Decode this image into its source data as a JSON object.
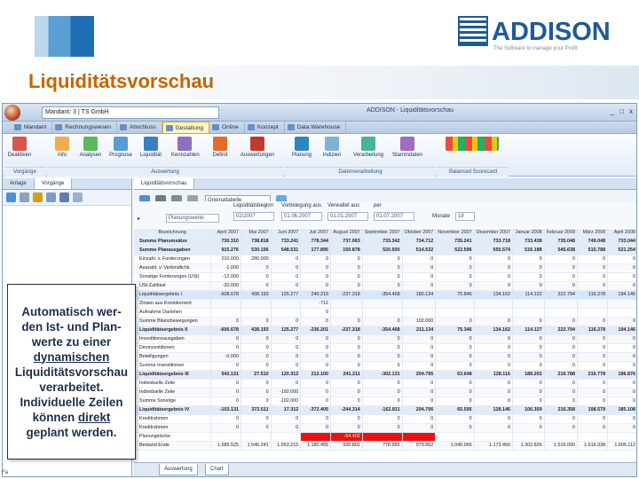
{
  "slide": {
    "title": "Liquiditätsvorschau",
    "brand_name": "ADDISON",
    "brand_tagline": "The Software to manage your Profit",
    "callout": {
      "line1": "Automatisch wer-",
      "line2": "den Ist- und Plan-",
      "line3": "werte zu einer",
      "line4": "dynamischen",
      "line5": "Liquiditätsvorschau",
      "line6": "verarbeitet.",
      "line7": "Individuelle Zeilen",
      "line8": "können ",
      "line8_underlined": "direkt",
      "line9": "geplant werden."
    }
  },
  "colors": {
    "title": "#c86400",
    "brand": "#1f5a98",
    "negative_highlight": "#ee1010",
    "callout_text": "#1c2f4a"
  },
  "app": {
    "mandant": "Mandant: 3 | TS GmbH",
    "window_title": "ADDISON - Liquiditätsvorschau",
    "win_controls": [
      "_",
      "□",
      "x"
    ],
    "ribbon_tabs": [
      "Mandant",
      "Rechnungswesen",
      "Abschluss",
      "Gestaltung",
      "Online",
      "Konzept",
      "Data Warehouse"
    ],
    "active_tab_index": 3,
    "ribbon_buttons": [
      "Deaktiven",
      "Info",
      "Analysen",
      "Prognose",
      "Liquidität",
      "Kennzahlen",
      "Definit",
      "Auswertungen",
      "Planung",
      "Indizien",
      "Verarbeitung",
      "Stammdaten",
      "Balanced Scorecard"
    ],
    "ribbon_groups": [
      "Vorgänge",
      "Auswertung",
      "Datenverarbeitung",
      "Balanced Scorecard"
    ],
    "left_pane_tabs": [
      "Anlage",
      "Vorgänge"
    ],
    "right_pane_tab": "Liquiditätsvorschau",
    "view_select": "Originaltabelle",
    "filter": {
      "view_label": "Planungswerte",
      "start_label": "Liquiditätsbeginn",
      "start_value": "02/2007",
      "vorgabe_label": "Vorbelegung aus",
      "vorgabe_value": "01.06.2007",
      "verwaltung_label": "Verwaltet aus",
      "verwaltung_value": "01.01.2007",
      "period_label": "per",
      "period_value": "01.07.2007",
      "monate_label": "Monate",
      "monate_value": "18"
    },
    "columns": [
      "Bezeichnung",
      "April 2007",
      "Mai 2007",
      "Juni 2007",
      "Juli 2007",
      "August 2007",
      "September 2007",
      "Oktober 2007",
      "November 2007",
      "Dezember 2007",
      "Januar 2008",
      "Februar 2008",
      "März 2008",
      "April 2008"
    ],
    "rows": [
      {
        "label": "Summe Planumsätze",
        "type": "sum",
        "values": [
          "730.310",
          "738.818",
          "733.241",
          "778.344",
          "737.063",
          "733.342",
          "734.712",
          "735.241",
          "733.718",
          "733.438",
          "735.048",
          "749.048",
          "733.044"
        ]
      },
      {
        "label": "Summe Planausgaben",
        "type": "sum",
        "values": [
          "915.276",
          "530.156",
          "548.531",
          "177.895",
          "150.878",
          "520.500",
          "514.532",
          "522.596",
          "555.574",
          "516.188",
          "545.638",
          "515.788",
          "521.254"
        ]
      },
      {
        "label": "Einzahl. v. Forderungen",
        "type": "row",
        "values": [
          "210.000",
          "280.000",
          "0",
          "0",
          "0",
          "0",
          "0",
          "0",
          "0",
          "0",
          "0",
          "0",
          "0"
        ]
      },
      {
        "label": "Auszahl. v. Verbindlichk.",
        "type": "row",
        "values": [
          "-1.000",
          "0",
          "0",
          "0",
          "0",
          "0",
          "0",
          "0",
          "0",
          "0",
          "0",
          "0",
          "0"
        ]
      },
      {
        "label": "Sonstige Forderungen (USt)",
        "type": "row",
        "values": [
          "-12.000",
          "0",
          "0",
          "0",
          "0",
          "0",
          "0",
          "0",
          "0",
          "0",
          "0",
          "0",
          "0"
        ]
      },
      {
        "label": "USt-Zahllast",
        "type": "row",
        "values": [
          "-20.000",
          "0",
          "0",
          "0",
          "0",
          "0",
          "0",
          "0",
          "0",
          "0",
          "0",
          "0",
          "0"
        ]
      },
      {
        "label": "Liquiditätsergebnis I",
        "type": "hl",
        "values": [
          "-608.678",
          "438.193",
          "125.277",
          "240.219",
          "-237.318",
          "-354.468",
          "180.134",
          "75.846",
          "134.162",
          "114.122",
          "222.794",
          "116.278",
          "194.146"
        ]
      },
      {
        "label": "Zinsen aus Kontokorrent",
        "type": "row",
        "values": [
          "",
          "",
          "",
          "-712",
          "",
          "",
          "",
          "",
          "",
          "",
          "",
          "",
          ""
        ]
      },
      {
        "label": "Aufnahme Darlehen",
        "type": "row",
        "values": [
          "",
          "",
          "",
          "0",
          "",
          "",
          "",
          "",
          "",
          "",
          "",
          "",
          ""
        ]
      },
      {
        "label": "Summe Bilanzbewegungen",
        "type": "row",
        "values": [
          "0",
          "0",
          "0",
          "0",
          "0",
          "0",
          "102.000",
          "0",
          "0",
          "0",
          "0",
          "0",
          "0"
        ]
      },
      {
        "label": "Liquiditätsergebnis II",
        "type": "sum",
        "values": [
          "-606.678",
          "438.193",
          "125.277",
          "-236.201",
          "-237.318",
          "-354.468",
          "211.134",
          "75.346",
          "134.162",
          "114.127",
          "222.794",
          "116.278",
          "194.146"
        ]
      },
      {
        "label": "Investitionsausgaben",
        "type": "row",
        "values": [
          "0",
          "0",
          "0",
          "0",
          "0",
          "0",
          "0",
          "0",
          "0",
          "0",
          "0",
          "0",
          "0"
        ]
      },
      {
        "label": "Desinvestitionen",
        "type": "row",
        "values": [
          "0",
          "0",
          "0",
          "0",
          "0",
          "0",
          "0",
          "0",
          "0",
          "0",
          "0",
          "0",
          "0"
        ]
      },
      {
        "label": "Beteiligungen",
        "type": "row",
        "values": [
          "-0.000",
          "0",
          "0",
          "0",
          "0",
          "0",
          "0",
          "0",
          "0",
          "0",
          "0",
          "0",
          "0"
        ]
      },
      {
        "label": "Summe Investitionen",
        "type": "row",
        "values": [
          "0",
          "0",
          "0",
          "0",
          "0",
          "0",
          "0",
          "0",
          "0",
          "0",
          "0",
          "0",
          "0"
        ]
      },
      {
        "label": "Liquiditätsergebnis III",
        "type": "sum",
        "values": [
          "542.131",
          "27.510",
          "120.312",
          "212.100",
          "241.211",
          "-302.131",
          "204.795",
          "63.648",
          "128.116",
          "188.202",
          "216.788",
          "216.778",
          "186.876"
        ]
      },
      {
        "label": "Individuelle Zeile",
        "type": "row",
        "values": [
          "0",
          "0",
          "0",
          "0",
          "0",
          "0",
          "0",
          "0",
          "0",
          "0",
          "0",
          "0",
          "0"
        ]
      },
      {
        "label": "Individuelle Zeile",
        "type": "row",
        "values": [
          "0",
          "0",
          "-192.000",
          "0",
          "0",
          "0",
          "0",
          "0",
          "0",
          "0",
          "0",
          "0",
          "0"
        ]
      },
      {
        "label": "Summe Sonstige",
        "type": "row",
        "values": [
          "0",
          "0",
          "-102.000",
          "0",
          "0",
          "0",
          "0",
          "0",
          "0",
          "0",
          "0",
          "0",
          "0"
        ]
      },
      {
        "label": "Liquiditätsergebnis IV",
        "type": "sum",
        "values": [
          "-102.131",
          "372.511",
          "17.312",
          "-372.405",
          "-244.314",
          "-162.811",
          "204.706",
          "65.595",
          "128.146",
          "106.359",
          "216.358",
          "198.579",
          "185.108"
        ]
      },
      {
        "label": "Kreditrahmen",
        "type": "row",
        "values": [
          "0",
          "0",
          "0",
          "0",
          "0",
          "0",
          "0",
          "0",
          "0",
          "0",
          "0",
          "0",
          "0"
        ]
      },
      {
        "label": "Kreditrahmen",
        "type": "row",
        "values": [
          "0",
          "0",
          "0",
          "0",
          "0",
          "0",
          "0",
          "0",
          "0",
          "0",
          "0",
          "0",
          "0"
        ]
      },
      {
        "label": "Planungslücke",
        "type": "gap",
        "values": [
          "",
          "",
          "",
          "",
          "-54.402",
          "",
          "",
          "",
          "",
          "",
          "",
          "",
          ""
        ]
      },
      {
        "label": "Bestand Ende",
        "type": "row",
        "values": [
          "1.685.525",
          "1.546.241",
          "1.553.215",
          "1.180.455",
          "935.802",
          "778.955",
          "979.662",
          "1.045.066",
          "1.173.456",
          "1.302.826",
          "1.516.000",
          "1.616.338",
          "1.605.112"
        ]
      }
    ],
    "sheet_tabs": [
      "Auswertung",
      "Chart"
    ],
    "status_text": "Fa"
  }
}
